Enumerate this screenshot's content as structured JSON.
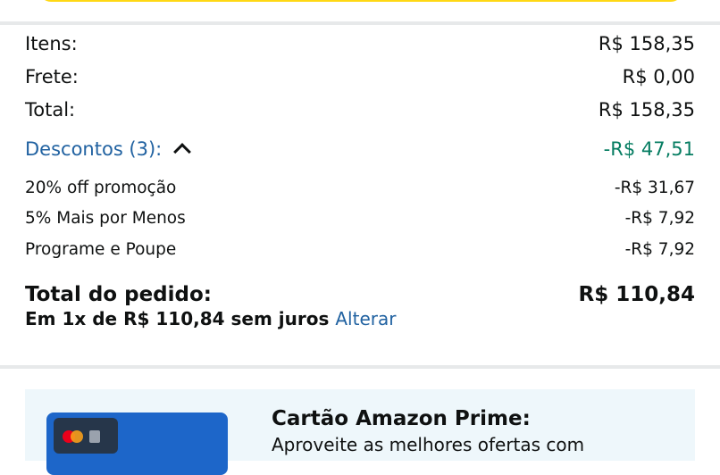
{
  "summary": {
    "items_label": "Itens:",
    "items_value": "R$ 158,35",
    "shipping_label": "Frete:",
    "shipping_value": "R$ 0,00",
    "total_label": "Total:",
    "total_value": "R$ 158,35",
    "discounts_label": "Descontos (3):",
    "discounts_value": "-R$ 47,51",
    "discounts": [
      {
        "label": "20% off promoção",
        "value": "-R$ 31,67"
      },
      {
        "label": "5% Mais por Menos",
        "value": "-R$ 7,92"
      },
      {
        "label": "Programe e Poupe",
        "value": "-R$ 7,92"
      }
    ],
    "order_total_label": "Total do pedido:",
    "order_total_value": "R$ 110,84",
    "installments_text": "Em 1x de R$ 110,84 sem juros",
    "installments_link": "Alterar"
  },
  "promo": {
    "title": "Cartão Amazon Prime:",
    "text": "Aproveite as melhores ofertas com"
  },
  "colors": {
    "link": "#2162a1",
    "discount": "#067d62",
    "button": "#ffd814",
    "promo_bg": "#eef7fb"
  }
}
